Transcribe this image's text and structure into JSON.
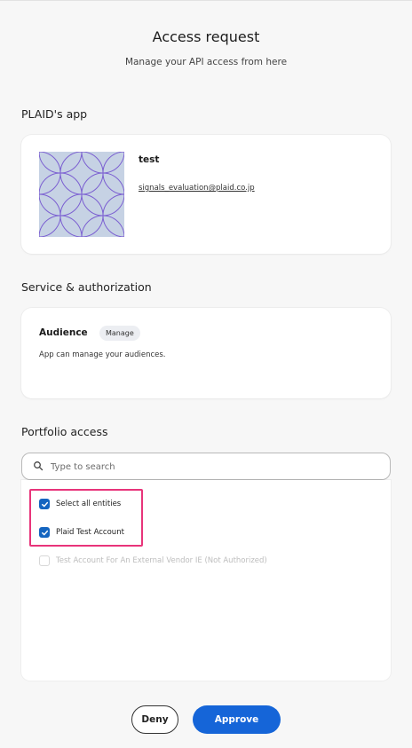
{
  "header": {
    "title": "Access request",
    "subtitle": "Manage your API access from here"
  },
  "app_section": {
    "heading": "PLAID's app",
    "app_name": "test",
    "email": "signals_evaluation@plaid.co.jp",
    "logo_icon": "circle-pattern-logo"
  },
  "service_section": {
    "heading": "Service & authorization",
    "scope_name": "Audience",
    "badge": "Manage",
    "description": "App can manage your audiences."
  },
  "portfolio_section": {
    "heading": "Portfolio access",
    "search_placeholder": "Type to search",
    "search_value": "",
    "items": [
      {
        "label": "Select all entities",
        "checked": true,
        "disabled": false
      },
      {
        "label": "Plaid Test Account",
        "checked": true,
        "disabled": false
      },
      {
        "label": "Test Account For An External Vendor IE (Not Authorized)",
        "checked": false,
        "disabled": true
      }
    ]
  },
  "actions": {
    "deny_label": "Deny",
    "approve_label": "Approve"
  },
  "colors": {
    "accent": "#1565d8",
    "checkbox": "#1565c0",
    "highlight": "#e8347a",
    "logo_bg": "#c6d2e4",
    "logo_stroke": "#7b5fd1"
  }
}
